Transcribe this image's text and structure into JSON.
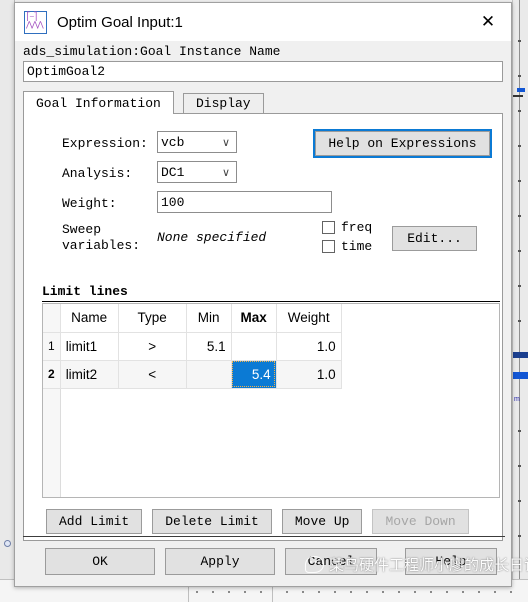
{
  "window": {
    "title": "Optim Goal Input:1",
    "icon": "waveform-icon",
    "close_label": "✕"
  },
  "instance": {
    "label": "ads_simulation:Goal Instance Name",
    "value": "OptimGoal2",
    "placeholder": "Goal Instance Name"
  },
  "tabs": [
    {
      "label": "Goal Information",
      "active": true
    },
    {
      "label": "Display",
      "active": false
    }
  ],
  "form": {
    "expression": {
      "label": "Expression:",
      "value": "vcb"
    },
    "analysis": {
      "label": "Analysis:",
      "value": "DC1"
    },
    "weight": {
      "label": "Weight:",
      "value": "100"
    },
    "sweep": {
      "label_line1": "Sweep",
      "label_line2": "variables:",
      "value": "None specified"
    },
    "checkboxes": [
      {
        "label": "freq",
        "checked": false
      },
      {
        "label": "time",
        "checked": false
      }
    ],
    "edit_button": "Edit...",
    "help_expressions_button": "Help on Expressions"
  },
  "limit_lines": {
    "title": "Limit lines",
    "columns": [
      "Name",
      "Type",
      "Min",
      "Max",
      "Weight"
    ],
    "bold_column": "Max",
    "rows": [
      {
        "index": "1",
        "Name": "limit1",
        "Type": ">",
        "Min": "5.1",
        "Max": "",
        "Weight": "1.0"
      },
      {
        "index": "2",
        "Name": "limit2",
        "Type": "<",
        "Min": "",
        "Max": "5.4",
        "Weight": "1.0"
      }
    ],
    "selected_cell": {
      "row": "2",
      "column": "Max",
      "value": "5.4"
    },
    "buttons": [
      {
        "label": "Add Limit",
        "enabled": true
      },
      {
        "label": "Delete Limit",
        "enabled": true
      },
      {
        "label": "Move Up",
        "enabled": true
      },
      {
        "label": "Move Down",
        "enabled": false
      }
    ]
  },
  "footer_buttons": [
    {
      "label": "OK"
    },
    {
      "label": "Apply"
    },
    {
      "label": "Cancel"
    },
    {
      "label": "Help"
    }
  ],
  "watermark": {
    "text": "菜鸟硬件工程师小廖的成长日记",
    "logo": "wechat-logo"
  },
  "colors": {
    "accent": "#0b7ad4",
    "selection": "#0b7ad4",
    "dialog_bg": "#f0f0f0",
    "panel_bg": "#ffffff",
    "button_bg": "#e1e1e1"
  },
  "background": {
    "mini_label": "m"
  }
}
